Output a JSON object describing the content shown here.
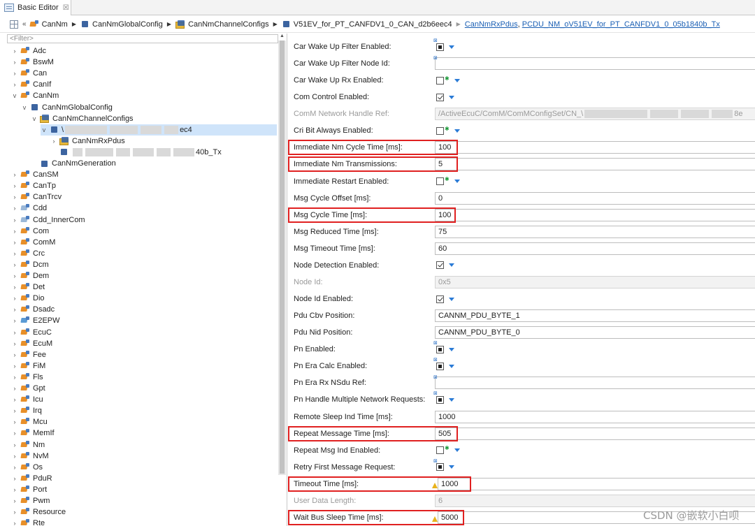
{
  "tab": {
    "title": "Basic Editor",
    "close": "☒"
  },
  "breadcrumb": {
    "items": [
      "CanNm",
      "CanNmGlobalConfig",
      "CanNmChannelConfigs",
      "V51EV_for_PT_CANFDV1_0_CAN_d2b6eec4"
    ],
    "links": [
      "CanNmRxPdus",
      "PCDU_NM_oV51EV_for_PT_CANFDV1_0_05b1840b_Tx"
    ],
    "separator": ","
  },
  "tree": {
    "filter_placeholder": "<Filter>",
    "modules_top": [
      "Adc",
      "BswM",
      "Can",
      "CanIf"
    ],
    "cannm": "CanNm",
    "cannm_global": "CanNmGlobalConfig",
    "cannm_channels": "CanNmChannelConfigs",
    "channel_prefix": "\\",
    "channel_suffix": "ec4",
    "rxpdus": "CanNmRxPdus",
    "txpdu_suffix": "40b_Tx",
    "generation": "CanNmGeneration",
    "modules_bottom": [
      "CanSM",
      "CanTp",
      "CanTrcv",
      "Cdd",
      "Cdd_InnerCom",
      "Com",
      "ComM",
      "Crc",
      "Dcm",
      "Dem",
      "Det",
      "Dio",
      "Dsadc",
      "E2EPW",
      "EcuC",
      "EcuM",
      "Fee",
      "FiM",
      "Fls",
      "Gpt",
      "Icu",
      "Irq",
      "Mcu",
      "MemIf",
      "Nm",
      "NvM",
      "Os",
      "PduR",
      "Port",
      "Pwm",
      "Resource",
      "Rte"
    ]
  },
  "props": {
    "rows": [
      {
        "label": "Car Wake Up Filter Enabled:",
        "kind": "filled"
      },
      {
        "label": "Car Wake Up Filter Node Id:",
        "kind": "field",
        "value": ""
      },
      {
        "label": "Car Wake Up Rx Enabled:",
        "kind": "unchecked"
      },
      {
        "label": "Com Control Enabled:",
        "kind": "checked"
      },
      {
        "label": "ComM Network Handle Ref:",
        "kind": "ref",
        "value": "/ActiveEcuC/ComM/ComMConfigSet/CN_\\",
        "value_end": "8e",
        "disabled": true
      },
      {
        "label": "Cri Bit Always Enabled:",
        "kind": "unchecked"
      },
      {
        "label": "Immediate Nm Cycle Time [ms]:",
        "kind": "field",
        "value": "100"
      },
      {
        "label": "Immediate Nm Transmissions:",
        "kind": "field",
        "value": "5"
      },
      {
        "label": "Immediate Restart Enabled:",
        "kind": "unchecked"
      },
      {
        "label": "Msg Cycle Offset [ms]:",
        "kind": "field",
        "value": "0"
      },
      {
        "label": "Msg Cycle Time [ms]:",
        "kind": "field",
        "value": "100"
      },
      {
        "label": "Msg Reduced Time [ms]:",
        "kind": "field",
        "value": "75"
      },
      {
        "label": "Msg Timeout Time [ms]:",
        "kind": "field",
        "value": "60"
      },
      {
        "label": "Node Detection Enabled:",
        "kind": "checked"
      },
      {
        "label": "Node Id:",
        "kind": "field",
        "value": "0x5",
        "disabled": true
      },
      {
        "label": "Node Id Enabled:",
        "kind": "checked"
      },
      {
        "label": "Pdu Cbv Position:",
        "kind": "field",
        "value": "CANNM_PDU_BYTE_1"
      },
      {
        "label": "Pdu Nid Position:",
        "kind": "field",
        "value": "CANNM_PDU_BYTE_0"
      },
      {
        "label": "Pn Enabled:",
        "kind": "filled"
      },
      {
        "label": "Pn Era Calc Enabled:",
        "kind": "filled"
      },
      {
        "label": "Pn Era Rx NSdu Ref:",
        "kind": "field",
        "value": ""
      },
      {
        "label": "Pn Handle Multiple Network Requests:",
        "kind": "filled"
      },
      {
        "label": "Remote Sleep Ind Time [ms]:",
        "kind": "field",
        "value": "1000"
      },
      {
        "label": "Repeat Message Time [ms]:",
        "kind": "field",
        "value": "505"
      },
      {
        "label": "Repeat Msg Ind Enabled:",
        "kind": "unchecked"
      },
      {
        "label": "Retry First Message Request:",
        "kind": "filled"
      },
      {
        "label": "Timeout Time [ms]:",
        "kind": "field",
        "value": "1000",
        "warn": true
      },
      {
        "label": "User Data Length:",
        "kind": "field",
        "value": "6",
        "disabled": true
      },
      {
        "label": "Wait Bus Sleep Time [ms]:",
        "kind": "field",
        "value": "5000",
        "warn": true
      }
    ]
  },
  "watermark": "CSDN @嵌软小白呗"
}
